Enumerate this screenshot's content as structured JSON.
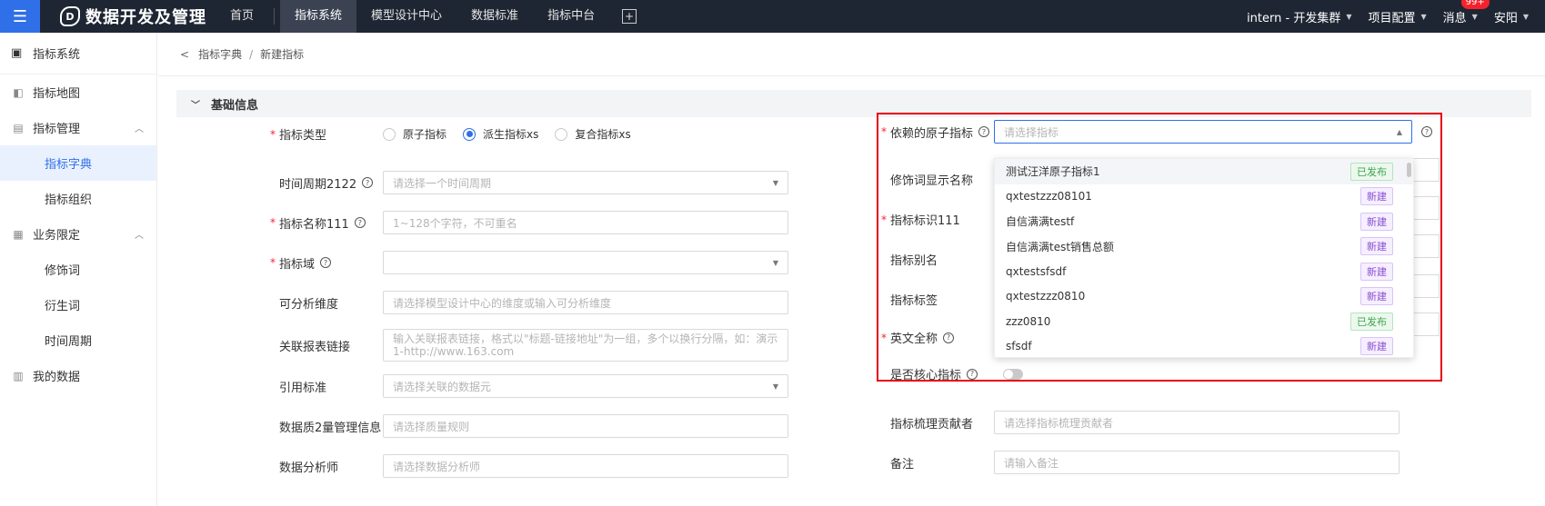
{
  "topbar": {
    "menu_icon": "hamburger-icon",
    "logo_mark": "D",
    "app_title": "数据开发及管理",
    "nav": [
      "首页",
      "指标系统",
      "模型设计中心",
      "数据标准",
      "指标中台"
    ],
    "cluster": "intern - 开发集群",
    "project_config": "项目配置",
    "messages": "消息",
    "badge": "99+",
    "user": "安阳"
  },
  "sidebar": {
    "header": "指标系统",
    "items": [
      {
        "label": "指标地图",
        "icon": "map-icon"
      },
      {
        "label": "指标管理",
        "icon": "folder-icon"
      },
      {
        "label": "指标字典",
        "sub": true,
        "active": true
      },
      {
        "label": "指标组织",
        "sub": true
      },
      {
        "label": "业务限定",
        "icon": "lock-icon"
      },
      {
        "label": "修饰词",
        "sub": true
      },
      {
        "label": "衍生词",
        "sub": true
      },
      {
        "label": "时间周期",
        "sub": true
      },
      {
        "label": "我的数据",
        "icon": "grid-icon"
      }
    ]
  },
  "breadcrumb": {
    "parent": "指标字典",
    "current": "新建指标",
    "sep": "/"
  },
  "section": {
    "title": "基础信息"
  },
  "form_left": {
    "type": {
      "label": "指标类型",
      "options": [
        "原子指标",
        "派生指标xs",
        "复合指标xs"
      ],
      "selected": 1
    },
    "period": {
      "label": "时间周期2122",
      "placeholder": "请选择一个时间周期"
    },
    "name": {
      "label": "指标名称111",
      "placeholder": "1~128个字符，不可重名"
    },
    "domain": {
      "label": "指标域",
      "placeholder": ""
    },
    "dims": {
      "label": "可分析维度",
      "placeholder": "请选择模型设计中心的维度或输入可分析维度"
    },
    "report": {
      "label": "关联报表链接",
      "placeholder": "输入关联报表链接，格式以\"标题-链接地址\"为一组，多个以换行分隔，如：演示1-http://www.163.com"
    },
    "standard": {
      "label": "引用标准",
      "placeholder": "请选择关联的数据元"
    },
    "quality": {
      "label": "数据质2量管理信息",
      "placeholder": "请选择质量规则"
    },
    "analyst": {
      "label": "数据分析师",
      "placeholder": "请选择数据分析师"
    }
  },
  "form_right": {
    "atomic": {
      "label": "依赖的原子指标",
      "placeholder": "请选择指标"
    },
    "modifier": {
      "label": "修饰词显示名称"
    },
    "ident": {
      "label": "指标标识111"
    },
    "alias": {
      "label": "指标别名"
    },
    "tags": {
      "label": "指标标签"
    },
    "english": {
      "label": "英文全称"
    },
    "core": {
      "label": "是否核心指标"
    },
    "contributor": {
      "label": "指标梳理贡献者",
      "placeholder": "请选择指标梳理贡献者"
    },
    "remark": {
      "label": "备注",
      "placeholder": "请输入备注"
    }
  },
  "dropdown": {
    "items": [
      {
        "name": "测试汪洋原子指标1",
        "status": "已发布",
        "kind": "published"
      },
      {
        "name": "qxtestzzz08101",
        "status": "新建",
        "kind": "new"
      },
      {
        "name": "自信满满testf",
        "status": "新建",
        "kind": "new"
      },
      {
        "name": "自信满满test销售总额",
        "status": "新建",
        "kind": "new"
      },
      {
        "name": "qxtestsfsdf",
        "status": "新建",
        "kind": "new"
      },
      {
        "name": "qxtestzzz0810",
        "status": "新建",
        "kind": "new"
      },
      {
        "name": "zzz0810",
        "status": "已发布",
        "kind": "published"
      },
      {
        "name": "sfsdf",
        "status": "新建",
        "kind": "new"
      }
    ]
  }
}
